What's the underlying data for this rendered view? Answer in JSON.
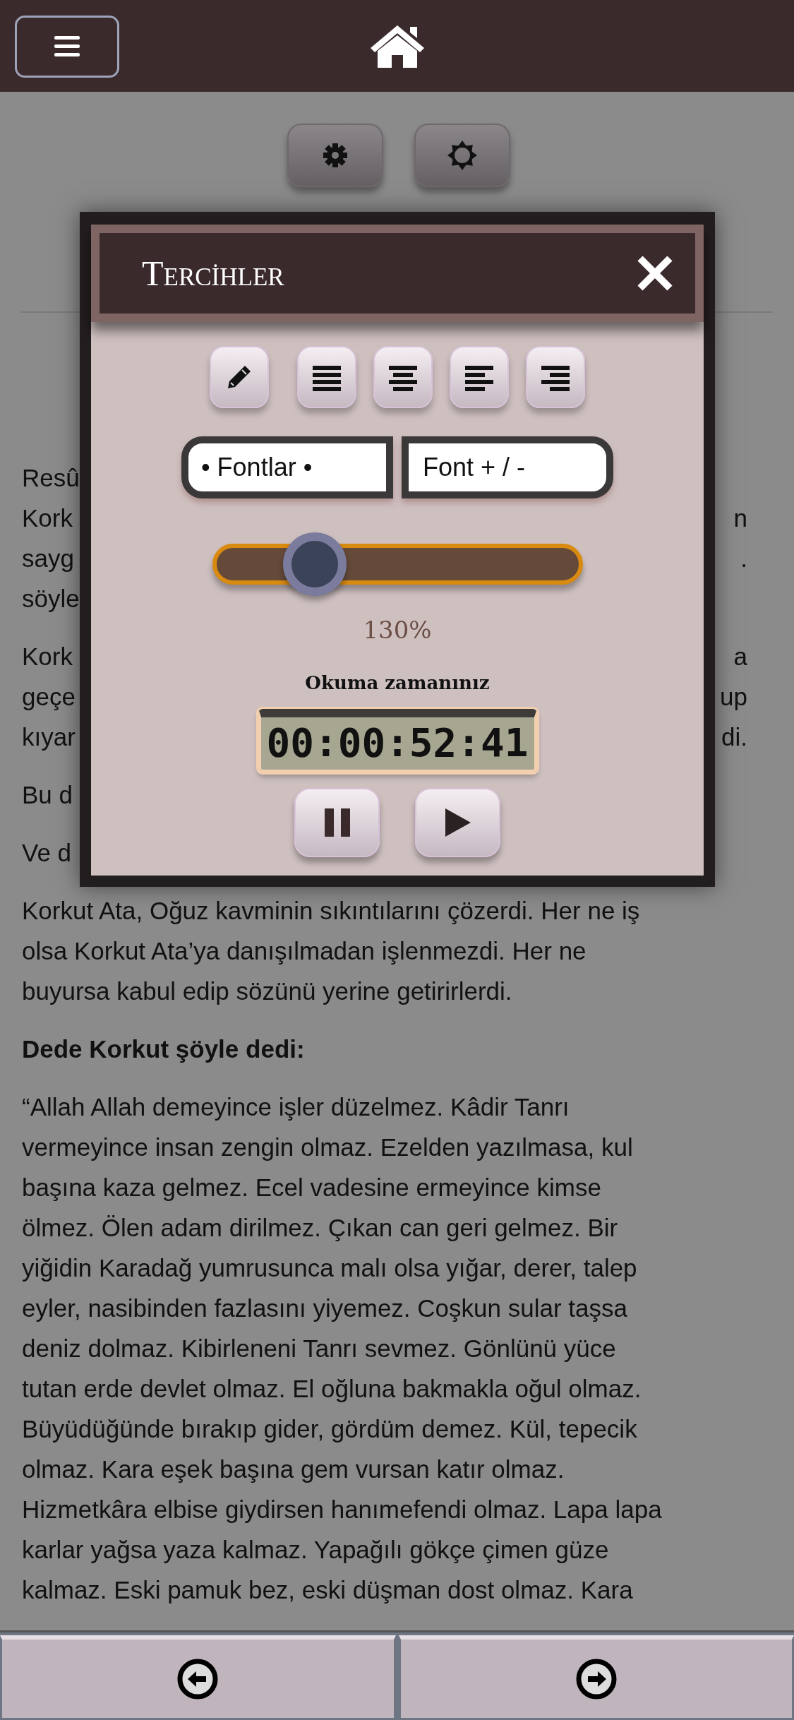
{
  "covered_paragraphs": [
    {
      "lines": [
        {
          "left": "Resû"
        },
        {
          "left": "Kork",
          "right": "n"
        },
        {
          "left": "sayg",
          "right": "."
        },
        {
          "left": "söyle"
        }
      ]
    },
    {
      "lines": [
        {
          "left": "Kork",
          "right": "a"
        },
        {
          "left": "geçe",
          "right": "up"
        },
        {
          "left": "kıyar",
          "right": "di."
        }
      ]
    },
    {
      "lines": [
        {
          "left": "Bu d"
        }
      ]
    },
    {
      "lines": [
        {
          "left": "Ve d"
        }
      ]
    }
  ],
  "paragraphs": [
    {
      "kind": "text",
      "lines": [
        "Korkut Ata, Oğuz kavminin sıkıntılarını çözerdi. Her ne iş",
        "olsa Korkut Ata’ya danışılmadan işlenmezdi. Her ne",
        "buyursa kabul edip sözünü yerine getirirlerdi."
      ]
    },
    {
      "kind": "heading",
      "lines": [
        "Dede Korkut şöyle dedi:"
      ]
    },
    {
      "kind": "text",
      "lines": [
        "“Allah Allah demeyince işler düzelmez. Kâdir Tanrı",
        "vermeyince insan zengin olmaz. Ezelden yazılmasa, kul",
        "başına kaza gelmez. Ecel vadesine ermeyince kimse",
        "ölmez. Ölen adam dirilmez. Çıkan can geri gelmez. Bir",
        "yiğidin Karadağ yumrusunca malı olsa yığar, derer, talep",
        "eyler, nasibinden fazlasını yiyemez. Coşkun sular taşsa",
        "deniz dolmaz. Kibirleneni Tanrı sevmez. Gönlünü yüce",
        "tutan erde devlet olmaz. El oğluna bakmakla oğul olmaz.",
        "Büyüdüğünde bırakıp gider, gördüm demez. Kül, tepecik",
        "olmaz. Kara eşek başına gem vursan katır olmaz.",
        "Hizmetkâra elbise giydirsen hanımefendi olmaz. Lapa lapa",
        "karlar yağsa yaza kalmaz. Yapağılı gökçe çimen güze",
        "kalmaz. Eski pamuk bez, eski düşman dost olmaz. Kara"
      ]
    }
  ],
  "dialog": {
    "title": "Tercihler",
    "tools": [
      {
        "kind": "edit"
      },
      {
        "kind": "justify"
      },
      {
        "kind": "center"
      },
      {
        "kind": "left"
      },
      {
        "kind": "right"
      }
    ],
    "font_select": "• Fontlar •",
    "font_size_button": "Font + / -",
    "zoom": {
      "level": 0.23
    },
    "zoom_reading": "130%",
    "timer_label": "Okuma zamanınız",
    "timer": "00:00:52:41"
  }
}
